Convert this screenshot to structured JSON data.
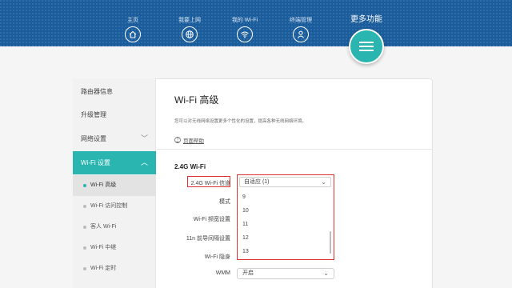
{
  "nav": {
    "items": [
      {
        "label": "主页",
        "icon": "home-icon"
      },
      {
        "label": "我要上网",
        "icon": "globe-icon"
      },
      {
        "label": "我的 Wi-Fi",
        "icon": "wifi-icon"
      },
      {
        "label": "终端管理",
        "icon": "user-icon"
      }
    ],
    "more_label": "更多功能",
    "accent": "#2ab5b0",
    "bar_color": "#1b5c9c"
  },
  "sidebar": {
    "items": [
      "路由器信息",
      "升级管理",
      "网络设置",
      "Wi-Fi 设置"
    ],
    "sub_items": [
      "Wi-Fi 高级",
      "Wi-Fi 访问控制",
      "客人 Wi-Fi",
      "Wi-Fi 中继",
      "Wi-Fi 定时"
    ]
  },
  "content": {
    "title": "Wi-Fi 高级",
    "description": "您可以对无线网络设置更多个性化的设置，提高各种无线网络环境。",
    "help": "页面帮助",
    "section": "2.4G Wi-Fi",
    "rows": {
      "channel": "2.4G Wi-Fi 信道",
      "mode": "模式",
      "bandwidth": "Wi-Fi 频宽设置",
      "interval": "11n 前导间隔设置",
      "hidden": "Wi-Fi 隐身",
      "wmm": "WMM"
    },
    "channel_value": "自适应 (1)",
    "channel_options": [
      "9",
      "10",
      "11",
      "12",
      "13"
    ],
    "wmm_value": "开启",
    "highlight_color": "#e0302b"
  }
}
